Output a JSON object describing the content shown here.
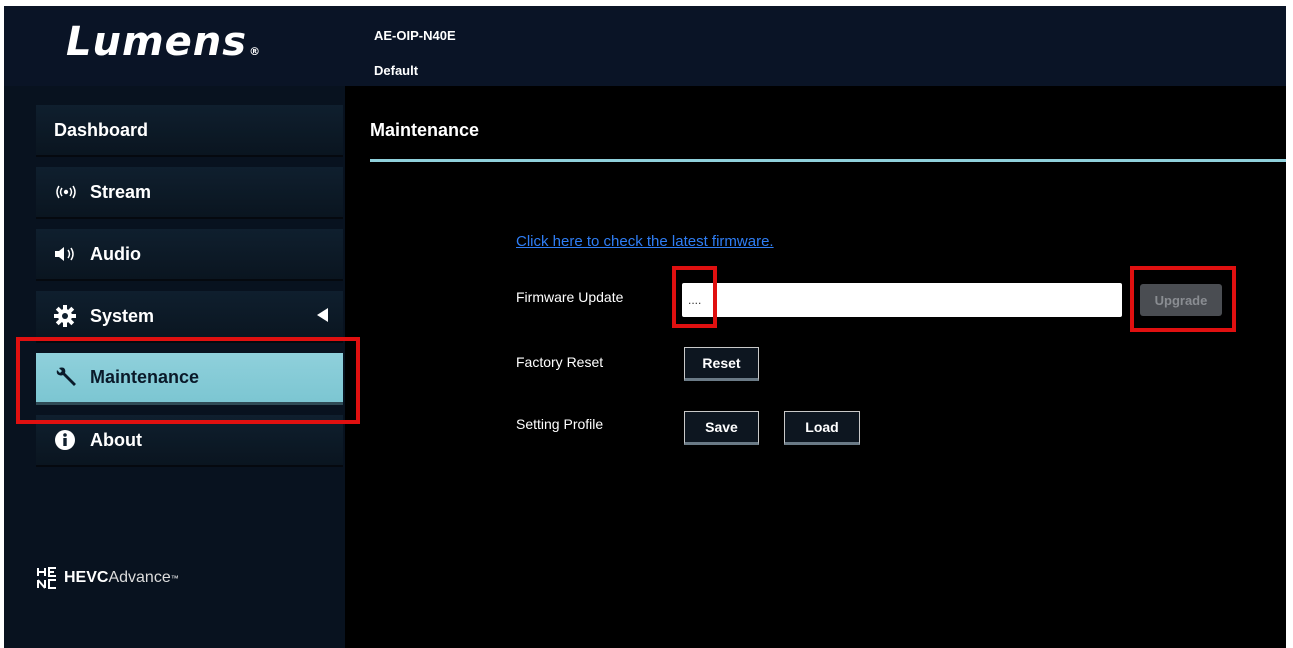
{
  "header": {
    "logo": "Lumens",
    "logo_mark": "®",
    "model": "AE-OIP-N40E",
    "profile": "Default"
  },
  "sidebar": {
    "items": [
      {
        "label": "Dashboard",
        "icon": ""
      },
      {
        "label": "Stream",
        "icon": "stream-icon"
      },
      {
        "label": "Audio",
        "icon": "speaker-icon"
      },
      {
        "label": "System",
        "icon": "gear-icon"
      },
      {
        "label": "Maintenance",
        "icon": "wrench-icon",
        "active": true
      },
      {
        "label": "About",
        "icon": "info-icon"
      }
    ],
    "footer_logo": {
      "text_bold": "HEVC",
      "text_light": "Advance",
      "mark": "™"
    }
  },
  "main": {
    "title": "Maintenance",
    "firmware_link": "Click here to check the latest firmware.",
    "firmware_update_label": "Firmware Update",
    "firmware_input_value": "....",
    "upgrade_label": "Upgrade",
    "factory_reset_label": "Factory Reset",
    "reset_label": "Reset",
    "setting_profile_label": "Setting Profile",
    "save_label": "Save",
    "load_label": "Load"
  },
  "colors": {
    "accent": "#8fd0db",
    "highlight": "#e01010",
    "link": "#2f7ef5"
  }
}
